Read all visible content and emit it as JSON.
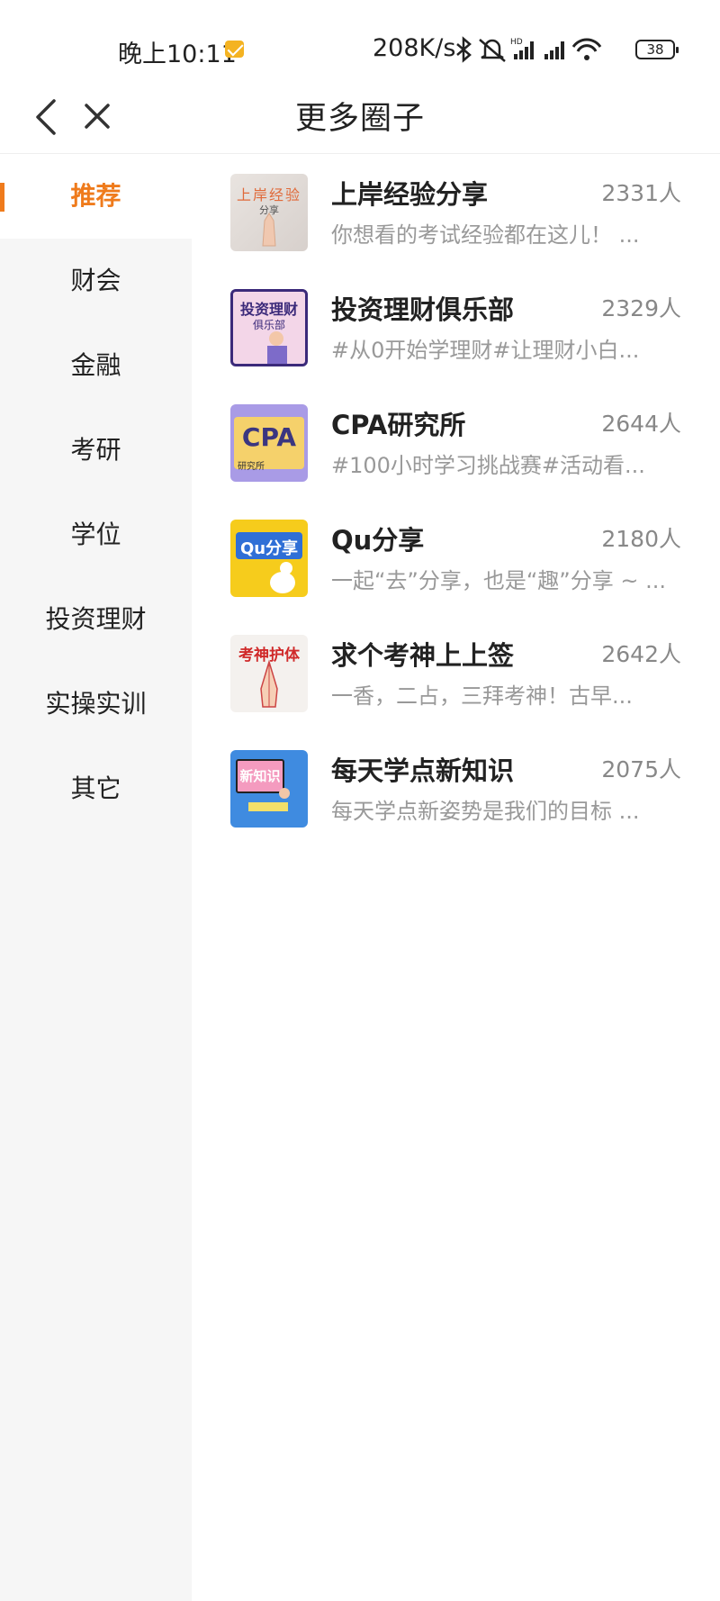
{
  "status": {
    "time": "晚上10:11",
    "speed": "208K/s",
    "battery": "38",
    "icons": [
      "mail-icon",
      "bluetooth-icon",
      "mute-icon",
      "hd-signal-icon",
      "signal-icon",
      "wifi-icon",
      "battery-icon"
    ]
  },
  "header": {
    "title": "更多圈子"
  },
  "sidebar": {
    "items": [
      {
        "label": "推荐"
      },
      {
        "label": "财会"
      },
      {
        "label": "金融"
      },
      {
        "label": "考研"
      },
      {
        "label": "学位"
      },
      {
        "label": "投资理财"
      },
      {
        "label": "实操实训"
      },
      {
        "label": "其它"
      }
    ]
  },
  "groups": [
    {
      "name": "上岸经验分享",
      "count": "2331人",
      "desc": "你想看的考试经验都在这儿！ ...",
      "thumb_text": "上岸经验",
      "thumb_sub": "分享"
    },
    {
      "name": "投资理财俱乐部",
      "count": "2329人",
      "desc": "#从0开始学理财#让理财小白...",
      "thumb_text": "投资理财",
      "thumb_sub": "俱乐部"
    },
    {
      "name": "CPA研究所",
      "count": "2644人",
      "desc": "#100小时学习挑战赛#活动看...",
      "thumb_text": "CPA",
      "thumb_sub": "研究所"
    },
    {
      "name": "Qu分享",
      "count": "2180人",
      "desc": "一起“去”分享，也是“趣”分享 ~ ...",
      "thumb_text": "Qu分享",
      "thumb_sub": ""
    },
    {
      "name": "求个考神上上签",
      "count": "2642人",
      "desc": "一香，二占，三拜考神！古早...",
      "thumb_text": "考神护体",
      "thumb_sub": ""
    },
    {
      "name": "每天学点新知识",
      "count": "2075人",
      "desc": "每天学点新姿势是我们的目标 ...",
      "thumb_text": "新知识",
      "thumb_sub": ""
    }
  ],
  "colors": {
    "accent": "#ef7b1c",
    "sidebar_bg": "#f6f6f6"
  }
}
